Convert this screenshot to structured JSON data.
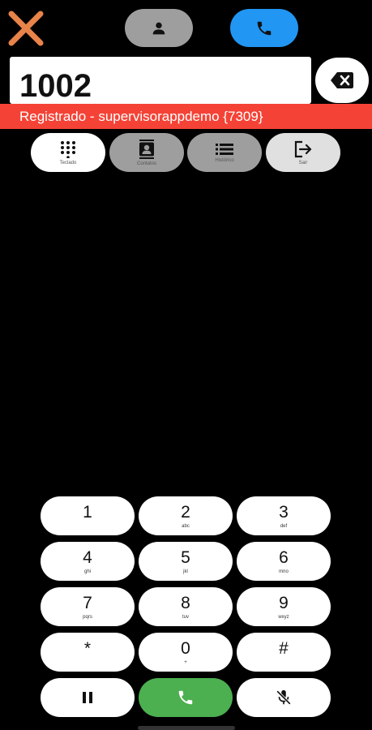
{
  "header": {
    "close_icon": "close-x-icon",
    "close_color": "#e8834a",
    "contact_button_icon": "person-icon",
    "call_button_icon": "phone-icon"
  },
  "dialer": {
    "number": "1002",
    "backspace_icon": "backspace-icon"
  },
  "status": {
    "text": "Registrado - supervisorappdemo {7309}",
    "color": "#f44336"
  },
  "tabs": [
    {
      "label": "Teclado",
      "icon": "dialpad-icon"
    },
    {
      "label": "Contatos",
      "icon": "contacts-icon"
    },
    {
      "label": "Histórico",
      "icon": "list-icon"
    },
    {
      "label": "Sair",
      "icon": "logout-icon"
    }
  ],
  "keypad": {
    "keys": [
      {
        "digit": "1",
        "letters": ""
      },
      {
        "digit": "2",
        "letters": "abc"
      },
      {
        "digit": "3",
        "letters": "def"
      },
      {
        "digit": "4",
        "letters": "ghi"
      },
      {
        "digit": "5",
        "letters": "jkl"
      },
      {
        "digit": "6",
        "letters": "mno"
      },
      {
        "digit": "7",
        "letters": "pqrs"
      },
      {
        "digit": "8",
        "letters": "tuv"
      },
      {
        "digit": "9",
        "letters": "wxyz"
      },
      {
        "digit": "*",
        "letters": ""
      },
      {
        "digit": "0",
        "letters": "+"
      },
      {
        "digit": "#",
        "letters": ""
      }
    ],
    "hold_icon": "pause-icon",
    "call_icon": "phone-icon",
    "mute_icon": "mic-off-icon",
    "call_color": "#4caf50"
  }
}
